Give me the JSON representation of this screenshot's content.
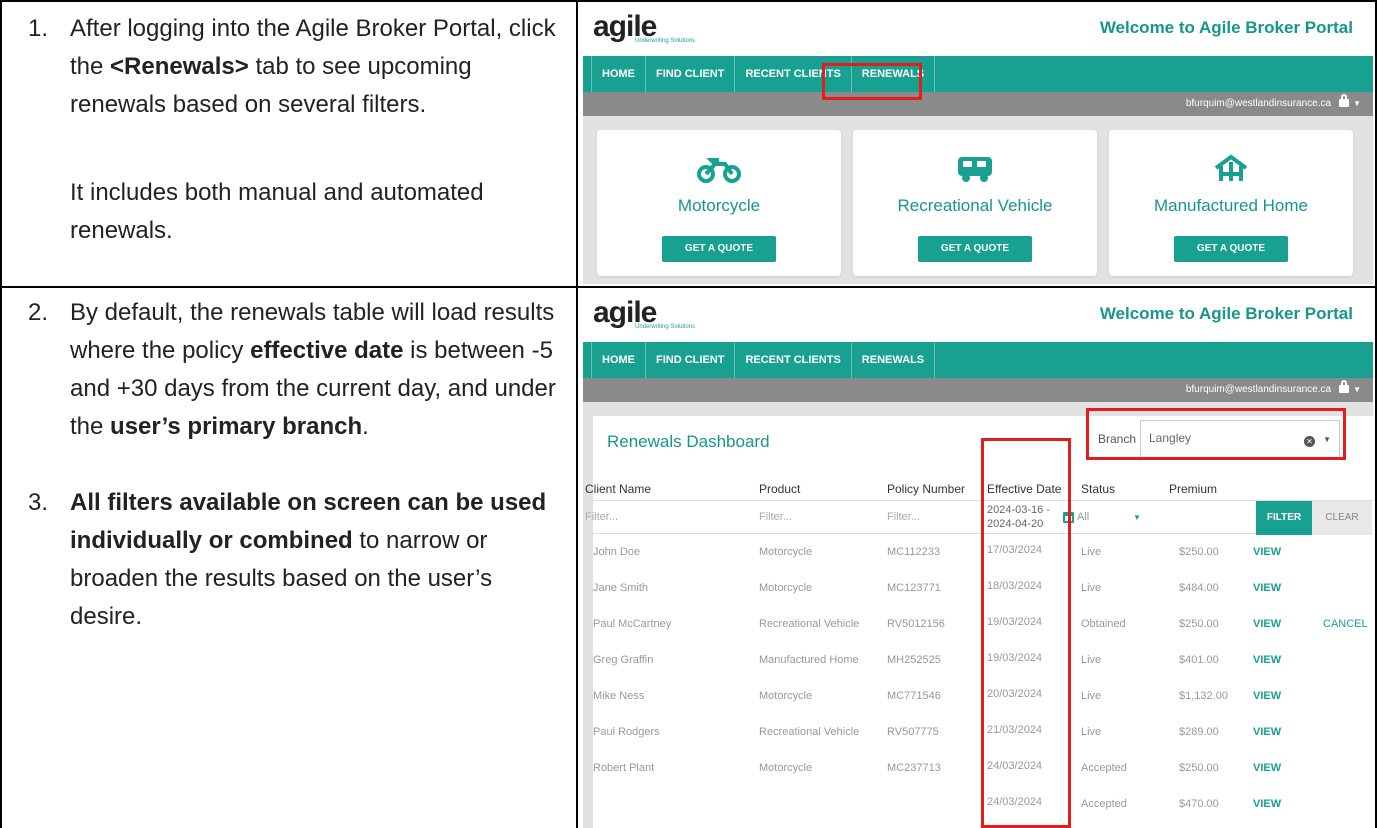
{
  "steps": {
    "s1": {
      "num": "1.",
      "pre": "After logging into the Agile Broker Portal, click the ",
      "strong": "<Renewals>",
      "post": " tab to see upcoming renewals based on several filters.",
      "note": "It includes both manual and automated renewals."
    },
    "s2": {
      "num": "2.",
      "pre": "By default, the renewals table will load results where the policy ",
      "strong1": "effective date",
      "mid": " is between -5 and +30 days from the current day, and under the ",
      "strong2": "user’s primary branch",
      "post": "."
    },
    "s3": {
      "num": "3.",
      "strong": "All filters available on screen can be used individually or combined",
      "post": " to narrow or broaden the results based on the user’s desire."
    }
  },
  "portal": {
    "logo": "agile",
    "logo_sub": "Underwriting Solutions",
    "welcome": "Welcome to Agile Broker Portal",
    "nav": [
      "HOME",
      "FIND CLIENT",
      "RECENT CLIENTS",
      "RENEWALS"
    ],
    "user_email": "bfurquim@westlandinsurance.ca",
    "cards": [
      {
        "title": "Motorcycle",
        "icon": "motorcycle-icon",
        "button": "GET A QUOTE"
      },
      {
        "title": "Recreational Vehicle",
        "icon": "rv-icon",
        "button": "GET A QUOTE"
      },
      {
        "title": "Manufactured Home",
        "icon": "home-icon",
        "button": "GET A QUOTE"
      }
    ]
  },
  "dashboard": {
    "title": "Renewals Dashboard",
    "branch_label": "Branch",
    "branch_value": "Langley",
    "columns": [
      "Client Name",
      "Product",
      "Policy Number",
      "Effective Date",
      "Status",
      "Premium"
    ],
    "filter_placeholder": "Filter...",
    "date_range_start": "2024-03-16 -",
    "date_range_end": "2024-04-20",
    "status_filter": "All",
    "filter_button": "FILTER",
    "clear_button": "CLEAR",
    "view_label": "VIEW",
    "cancel_label": "CANCEL",
    "rows": [
      {
        "client": "John Doe",
        "product": "Motorcycle",
        "policy": "MC112233",
        "date": "17/03/2024",
        "status": "Live",
        "premium": "$250.00"
      },
      {
        "client": "Jane Smith",
        "product": "Motorcycle",
        "policy": "MC123771",
        "date": "18/03/2024",
        "status": "Live",
        "premium": "$484.00"
      },
      {
        "client": "Paul McCartney",
        "product": "Recreational Vehicle",
        "policy": "RV5012156",
        "date": "19/03/2024",
        "status": "Obtained",
        "premium": "$250.00"
      },
      {
        "client": "Greg Graffin",
        "product": "Manufactured Home",
        "policy": "MH252525",
        "date": "19/03/2024",
        "status": "Live",
        "premium": "$401.00"
      },
      {
        "client": "Mike Ness",
        "product": "Motorcycle",
        "policy": "MC771546",
        "date": "20/03/2024",
        "status": "Live",
        "premium": "$1,132.00"
      },
      {
        "client": "Paul Rodgers",
        "product": "Recreational Vehicle",
        "policy": "RV507775",
        "date": "21/03/2024",
        "status": "Live",
        "premium": "$289.00"
      },
      {
        "client": "Robert Plant",
        "product": "Motorcycle",
        "policy": "MC237713",
        "date": "24/03/2024",
        "status": "Accepted",
        "premium": "$250.00"
      },
      {
        "client": "",
        "product": "",
        "policy": "",
        "date": "24/03/2024",
        "status": "Accepted",
        "premium": "$470.00"
      }
    ]
  },
  "colors": {
    "teal": "#18a190",
    "highlight": "#e31d1d",
    "grey_bar": "#8a8a8a"
  }
}
